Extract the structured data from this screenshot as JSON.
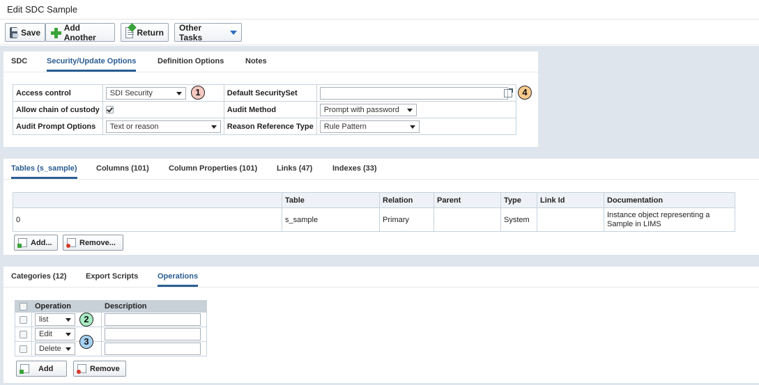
{
  "window": {
    "title": "Edit SDC Sample"
  },
  "toolbar": {
    "save_label": "Save",
    "add_another_label": "Add Another",
    "return_label": "Return",
    "other_tasks_label": "Other Tasks"
  },
  "top_tabs": {
    "items": [
      {
        "label": "SDC"
      },
      {
        "label": "Security/Update Options"
      },
      {
        "label": "Definition Options"
      },
      {
        "label": "Notes"
      }
    ],
    "active": "Security/Update Options"
  },
  "security": {
    "access_control_label": "Access control",
    "access_control_value": "SDI Security",
    "default_securityset_label": "Default SecuritySet",
    "default_securityset_value": "",
    "allow_chain_label": "Allow chain of custody",
    "allow_chain_checked": true,
    "audit_method_label": "Audit Method",
    "audit_method_value": "Prompt with password",
    "audit_prompt_label": "Audit Prompt Options",
    "audit_prompt_value": "Text or reason",
    "reason_ref_label": "Reason Reference Type",
    "reason_ref_value": "Rule Pattern"
  },
  "badges": [
    "1",
    "2",
    "3",
    "4"
  ],
  "table_tabs": {
    "items": [
      {
        "label": "Tables (s_sample)"
      },
      {
        "label": "Columns (101)"
      },
      {
        "label": "Column Properties (101)"
      },
      {
        "label": "Links (47)"
      },
      {
        "label": "Indexes (33)"
      }
    ],
    "active": "Tables (s_sample)"
  },
  "tables_grid": {
    "headers": [
      "",
      "Table",
      "Relation",
      "Parent",
      "Type",
      "Link Id",
      "Documentation"
    ],
    "rows": [
      {
        "index": "0",
        "table": "s_sample",
        "relation": "Primary",
        "parent": "",
        "type": "System",
        "link_id": "",
        "doc_line1": "Instance object representing a",
        "doc_line2": "Sample in LIMS"
      }
    ],
    "add_label": "Add...",
    "remove_label": "Remove..."
  },
  "bottom_tabs": {
    "items": [
      {
        "label": "Categories (12)"
      },
      {
        "label": "Export Scripts"
      },
      {
        "label": "Operations"
      }
    ],
    "active": "Operations"
  },
  "operations": {
    "headers": [
      "Operation",
      "Description"
    ],
    "rows": [
      {
        "operation": "list",
        "description": ""
      },
      {
        "operation": "Edit",
        "description": ""
      },
      {
        "operation": "Delete",
        "description": ""
      }
    ],
    "add_label": "Add",
    "remove_label": "Remove"
  },
  "colors": {
    "accent": "#2a5d93",
    "background": "#dfe5ec",
    "badge1": "#f6c9c3",
    "badge2": "#a8ecc4",
    "badge3": "#a6d2f2",
    "badge4": "#f9c98c"
  }
}
